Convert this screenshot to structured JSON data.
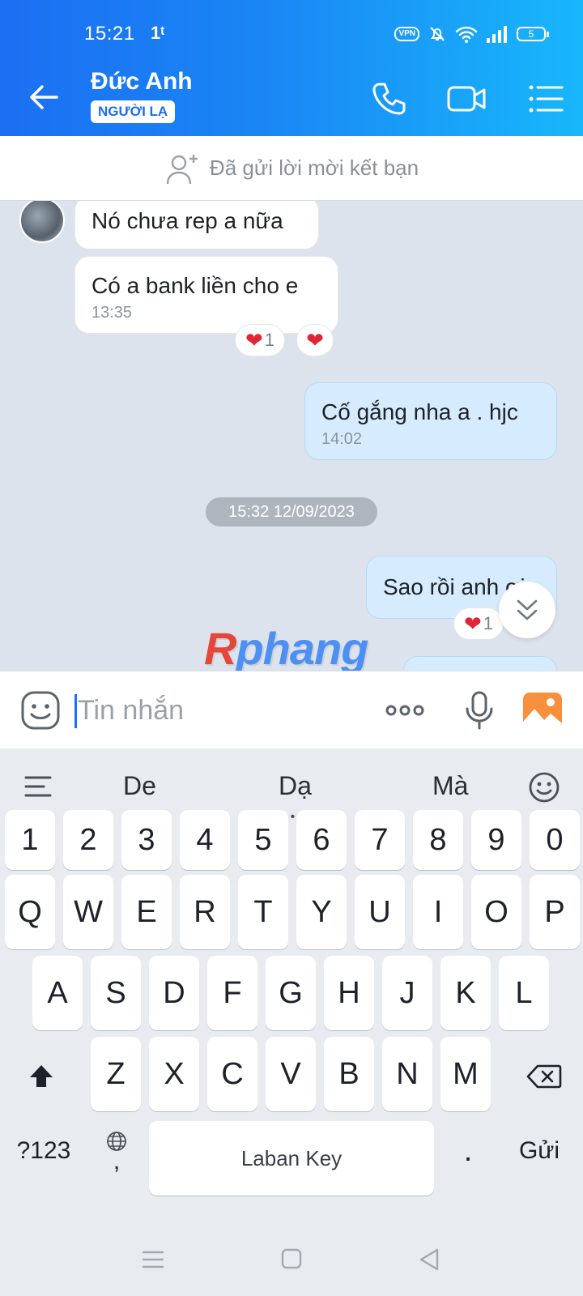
{
  "status_bar": {
    "time": "15:21",
    "network": "1ᵗ",
    "vpn": "VPN",
    "battery": "5"
  },
  "header": {
    "contact_name": "Đức Anh",
    "badge": "NGƯỜI LẠ"
  },
  "friend_request": {
    "text": "Đã gửi lời mời kết bạn"
  },
  "messages": [
    {
      "side": "in",
      "text": "Nó chưa rep a nữa",
      "time": ""
    },
    {
      "side": "in",
      "text": "Có a bank liền cho e",
      "time": "13:35",
      "reaction_count": "1"
    },
    {
      "side": "out",
      "text": "Cố gắng nha a . hjc",
      "time": "14:02"
    },
    {
      "side": "out",
      "text": "Sao rồi anh ơi",
      "time": "",
      "reaction_count": "1"
    }
  ],
  "date_divider": "15:32 12/09/2023",
  "watermark": {
    "part1": "R",
    "part2": "phang"
  },
  "composer": {
    "placeholder": "Tin nhắn"
  },
  "keyboard": {
    "suggestions": [
      "De",
      "Dạ",
      "Mà"
    ],
    "row_numbers": [
      "1",
      "2",
      "3",
      "4",
      "5",
      "6",
      "7",
      "8",
      "9",
      "0"
    ],
    "row1": [
      "Q",
      "W",
      "E",
      "R",
      "T",
      "Y",
      "U",
      "I",
      "O",
      "P"
    ],
    "row2": [
      "A",
      "S",
      "D",
      "F",
      "G",
      "H",
      "J",
      "K",
      "L"
    ],
    "row3": [
      "Z",
      "X",
      "C",
      "V",
      "B",
      "N",
      "M"
    ],
    "symbols_key": "?123",
    "comma_key": ",",
    "space_label": "Laban Key",
    "period_key": ".",
    "send_key": "Gửi"
  },
  "colors": {
    "header_start": "#1b6ff2",
    "header_end": "#18b7fb",
    "outgoing_bubble": "#d6ecfe",
    "chat_bg": "#dde3ec",
    "heart": "#e02636"
  }
}
